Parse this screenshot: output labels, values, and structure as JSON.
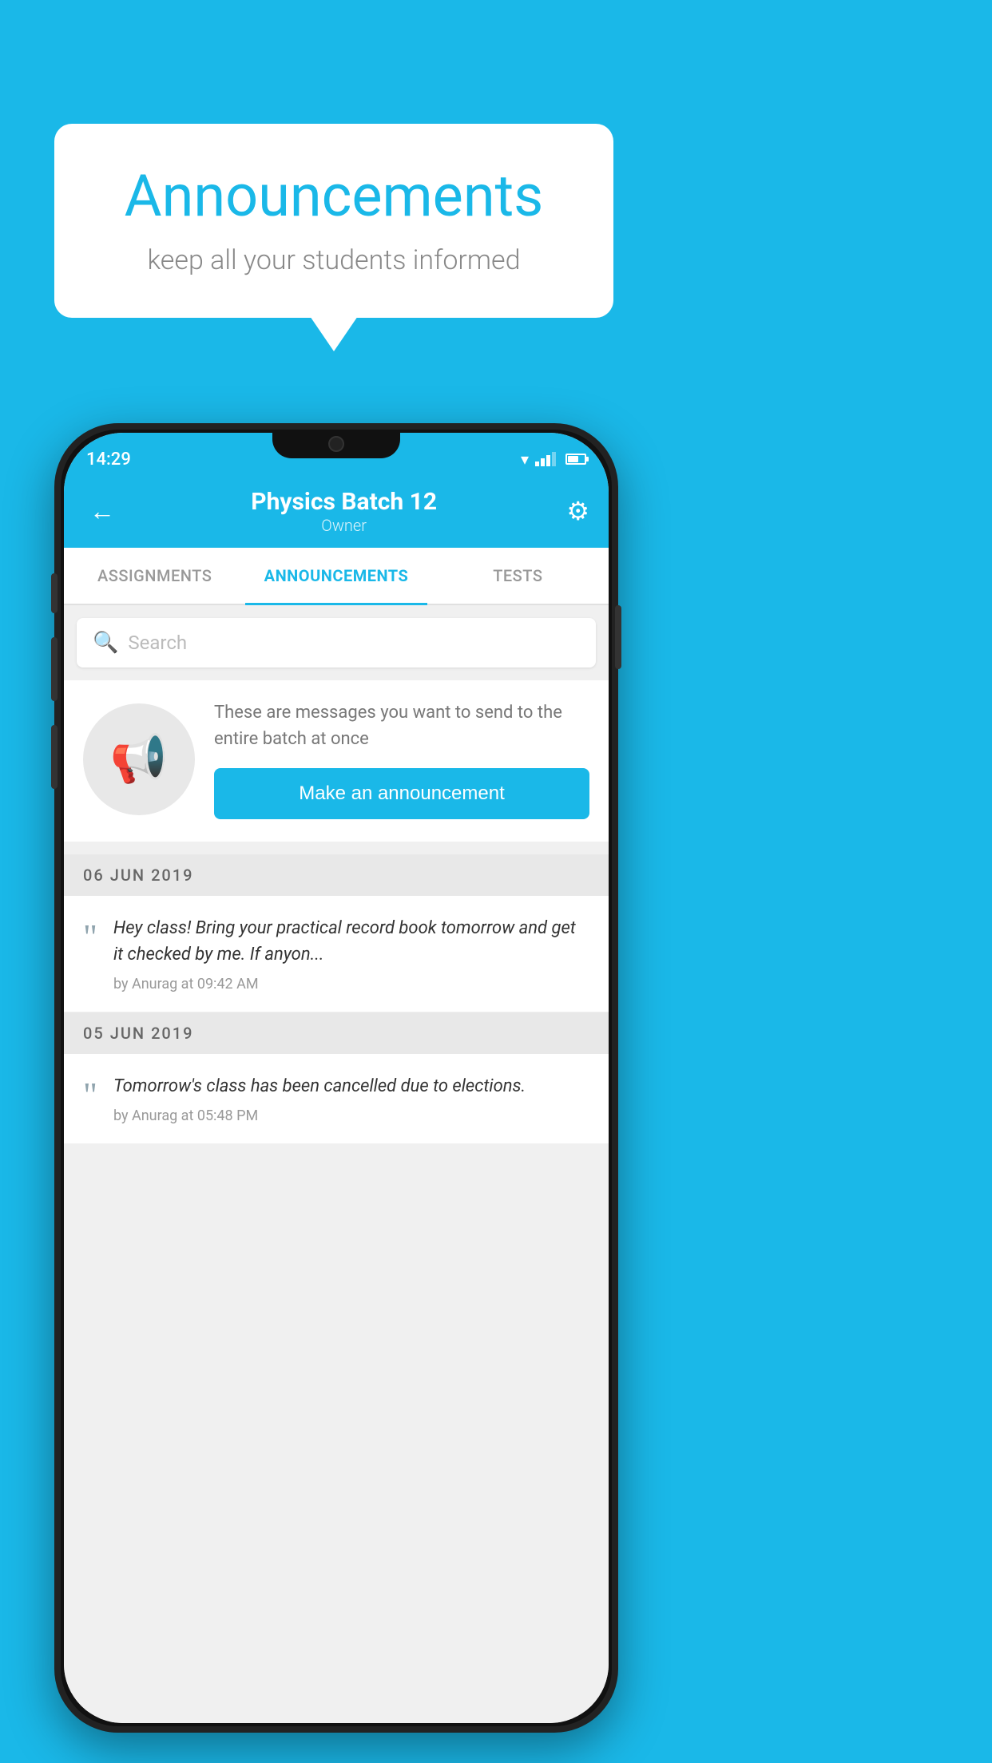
{
  "background_color": "#1ab8e8",
  "bubble": {
    "title": "Announcements",
    "subtitle": "keep all your students informed"
  },
  "phone": {
    "status_bar": {
      "time": "14:29"
    },
    "app_bar": {
      "title": "Physics Batch 12",
      "subtitle": "Owner",
      "back_label": "←",
      "settings_label": "⚙"
    },
    "tabs": [
      {
        "label": "ASSIGNMENTS",
        "active": false
      },
      {
        "label": "ANNOUNCEMENTS",
        "active": true
      },
      {
        "label": "TESTS",
        "active": false
      }
    ],
    "search": {
      "placeholder": "Search"
    },
    "announcement_prompt": {
      "description": "These are messages you want to send to the entire batch at once",
      "button_label": "Make an announcement"
    },
    "announcements": [
      {
        "date": "06  JUN  2019",
        "text": "Hey class! Bring your practical record book tomorrow and get it checked by me. If anyon...",
        "meta": "by Anurag at 09:42 AM"
      },
      {
        "date": "05  JUN  2019",
        "text": "Tomorrow's class has been cancelled due to elections.",
        "meta": "by Anurag at 05:48 PM"
      }
    ]
  }
}
